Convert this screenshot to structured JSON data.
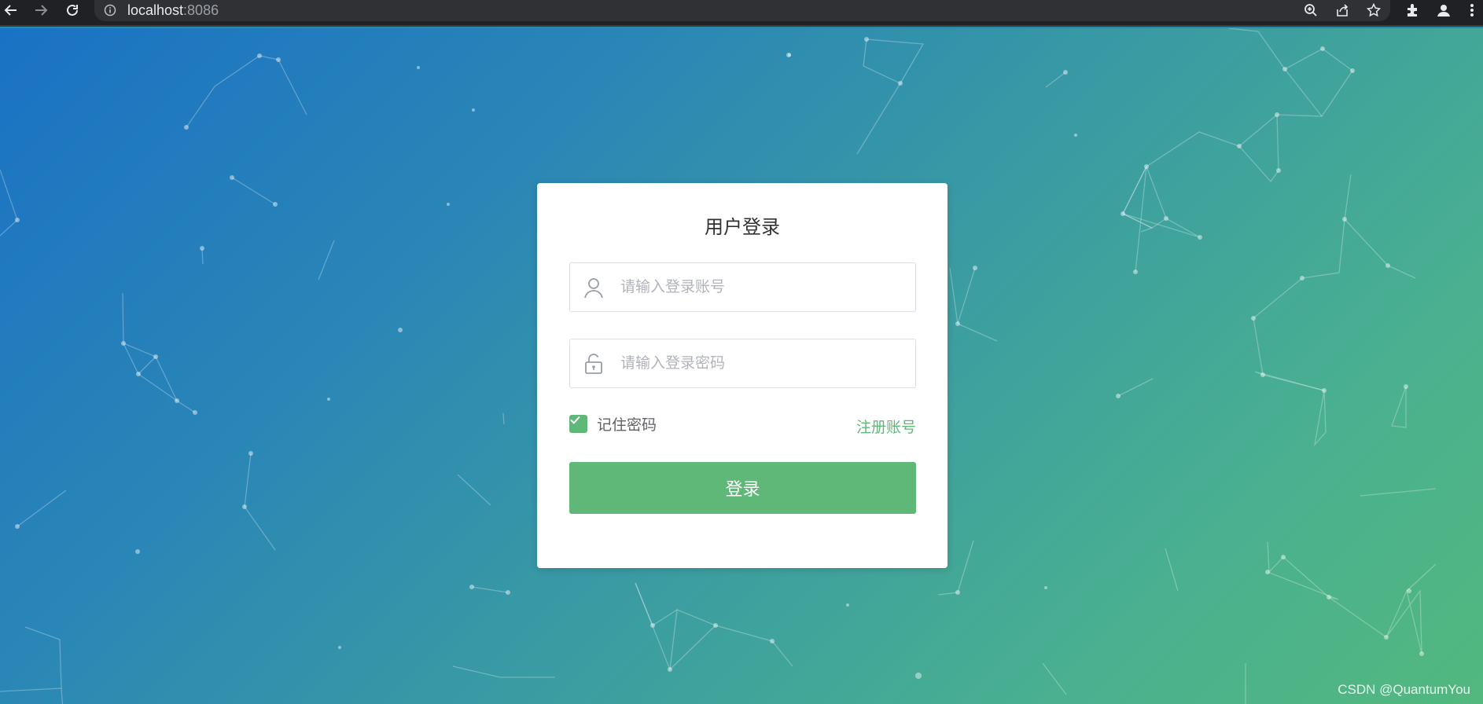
{
  "browser": {
    "url_host": "localhost",
    "url_port": ":8086",
    "icons": [
      "back-icon",
      "forward-icon",
      "reload-icon",
      "info-icon",
      "zoom-icon",
      "share-icon",
      "star-icon",
      "extensions-icon",
      "profile-icon",
      "menu-icon"
    ]
  },
  "login": {
    "title": "用户登录",
    "username_placeholder": "请输入登录账号",
    "password_placeholder": "请输入登录密码",
    "remember_label": "记住密码",
    "remember_checked": true,
    "register_label": "注册账号",
    "submit_label": "登录"
  },
  "colors": {
    "accent": "#5fb878",
    "gradient_start": "#1a72c4",
    "gradient_end": "#52b87e"
  },
  "watermark": "CSDN @QuantumYou"
}
